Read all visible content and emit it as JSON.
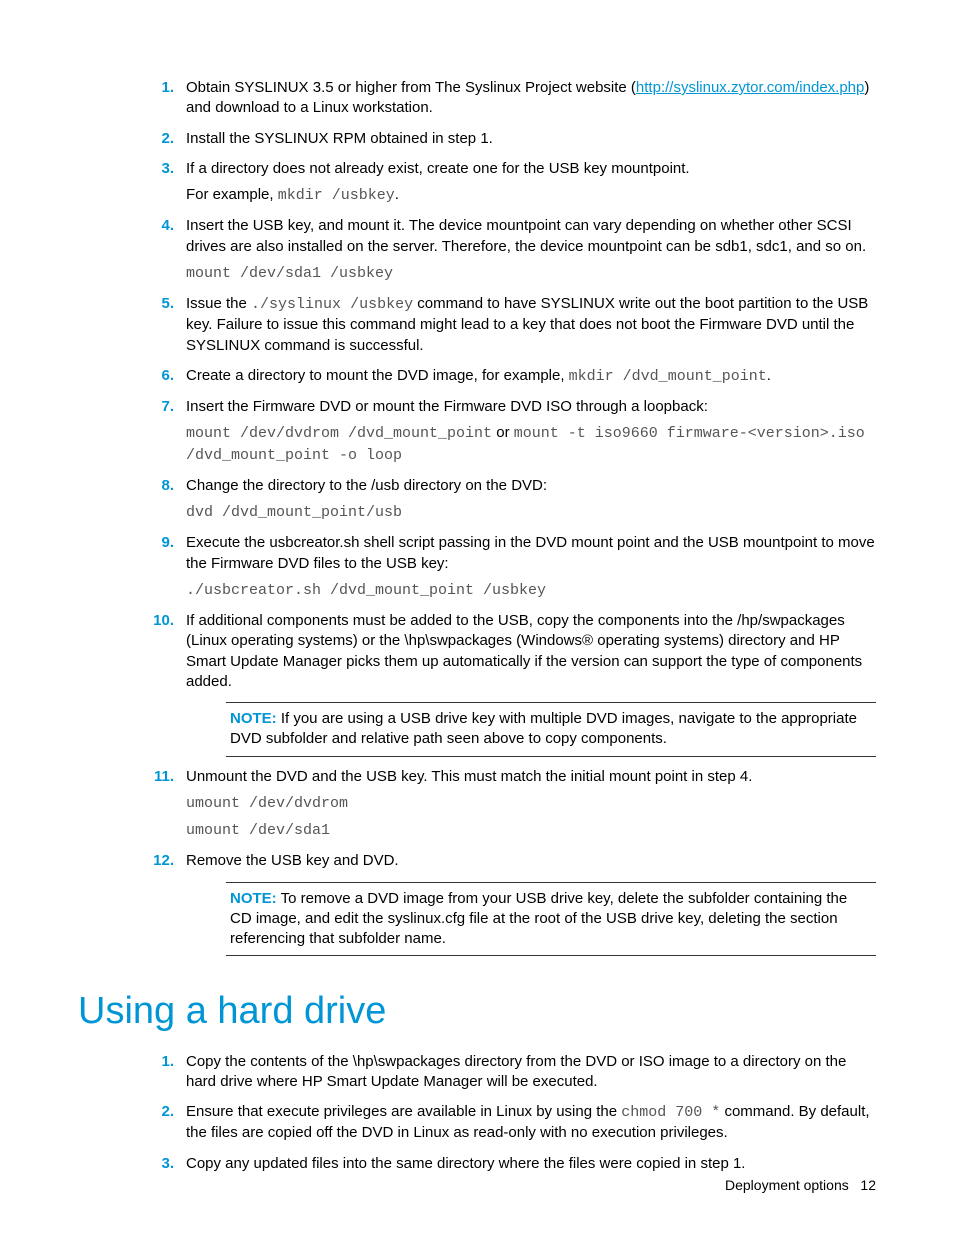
{
  "steps_a": [
    {
      "n": "1.",
      "parts": [
        {
          "t": "text",
          "v": "Obtain SYSLINUX 3.5 or higher from The Syslinux Project website ("
        },
        {
          "t": "link",
          "v": "http://syslinux.zytor.com/index.php"
        },
        {
          "t": "text",
          "v": ") and download to a Linux workstation."
        }
      ]
    },
    {
      "n": "2.",
      "parts": [
        {
          "t": "text",
          "v": "Install the SYSLINUX RPM obtained in step 1."
        }
      ]
    },
    {
      "n": "3.",
      "parts": [
        {
          "t": "text",
          "v": "If a directory does not already exist, create one for the USB key mountpoint."
        }
      ],
      "after": [
        {
          "t": "mixed",
          "pre": "For example, ",
          "code": "mkdir /usbkey",
          "post": "."
        }
      ]
    },
    {
      "n": "4.",
      "parts": [
        {
          "t": "text",
          "v": "Insert the USB key, and mount it. The device mountpoint can vary depending on whether other SCSI drives are also installed on the server. Therefore, the device mountpoint can be sdb1, sdc1, and so on."
        }
      ],
      "after": [
        {
          "t": "code",
          "v": "mount /dev/sda1 /usbkey"
        }
      ]
    },
    {
      "n": "5.",
      "parts": [
        {
          "t": "text",
          "v": "Issue the "
        },
        {
          "t": "code",
          "v": "./syslinux /usbkey"
        },
        {
          "t": "text",
          "v": " command to have SYSLINUX write out the boot partition to the USB key. Failure to issue this command might lead to a key that does not boot the Firmware DVD until the SYSLINUX command is successful."
        }
      ]
    },
    {
      "n": "6.",
      "parts": [
        {
          "t": "text",
          "v": "Create a directory to mount the DVD image, for example, "
        },
        {
          "t": "code",
          "v": "mkdir /dvd_mount_point"
        },
        {
          "t": "text",
          "v": "."
        }
      ]
    },
    {
      "n": "7.",
      "parts": [
        {
          "t": "text",
          "v": "Insert the Firmware DVD or mount the Firmware DVD ISO through a loopback:"
        }
      ],
      "after": [
        {
          "t": "codepair",
          "c1": "mount /dev/dvdrom /dvd_mount_point",
          "mid": " or ",
          "c2": "mount -t iso9660 firmware-<version>.iso /dvd_mount_point -o loop"
        }
      ]
    },
    {
      "n": "8.",
      "parts": [
        {
          "t": "text",
          "v": "Change the directory to the /usb directory on the DVD:"
        }
      ],
      "after": [
        {
          "t": "code",
          "v": "dvd /dvd_mount_point/usb"
        }
      ]
    },
    {
      "n": "9.",
      "parts": [
        {
          "t": "text",
          "v": "Execute the usbcreator.sh shell script passing in the DVD mount point and the USB mountpoint to move the Firmware DVD files to the USB key:"
        }
      ],
      "after": [
        {
          "t": "code",
          "v": "./usbcreator.sh /dvd_mount_point /usbkey"
        }
      ]
    },
    {
      "n": "10.",
      "parts": [
        {
          "t": "text",
          "v": "If additional components must be added to the USB, copy the components into the /hp/swpackages (Linux operating systems) or the \\hp\\swpackages (Windows® operating systems) directory and HP Smart Update Manager picks them up automatically if the version can support the type of components added."
        }
      ],
      "note": {
        "label": "NOTE:",
        "body": "  If you are using a USB drive key with multiple DVD images, navigate to the appropriate DVD subfolder and relative path seen above to copy components."
      }
    },
    {
      "n": "11.",
      "parts": [
        {
          "t": "text",
          "v": "Unmount the DVD and the USB key. This must match the initial mount point in step 4."
        }
      ],
      "after": [
        {
          "t": "code",
          "v": "umount /dev/dvdrom"
        },
        {
          "t": "code",
          "v": "umount /dev/sda1"
        }
      ]
    },
    {
      "n": "12.",
      "parts": [
        {
          "t": "text",
          "v": "Remove the USB key and DVD."
        }
      ],
      "note": {
        "label": "NOTE:",
        "body": "  To remove a DVD image from your USB drive key, delete the subfolder containing the CD image, and edit the syslinux.cfg file at the root of the USB drive key, deleting the section referencing that subfolder name."
      }
    }
  ],
  "section_b_title": "Using a hard drive",
  "steps_b": [
    {
      "n": "1.",
      "parts": [
        {
          "t": "text",
          "v": "Copy the contents of the \\hp\\swpackages directory from the DVD or ISO image to a directory on the hard drive where HP Smart Update Manager will be executed."
        }
      ]
    },
    {
      "n": "2.",
      "parts": [
        {
          "t": "text",
          "v": "Ensure that execute privileges are available in Linux by using the "
        },
        {
          "t": "code",
          "v": "chmod 700 *"
        },
        {
          "t": "text",
          "v": " command. By default, the files are copied off the DVD in Linux as read-only with no execution privileges."
        }
      ]
    },
    {
      "n": "3.",
      "parts": [
        {
          "t": "text",
          "v": "Copy any updated files into the same directory where the files were copied in step 1."
        }
      ]
    }
  ],
  "footer": {
    "title": "Deployment options",
    "page": "12"
  }
}
